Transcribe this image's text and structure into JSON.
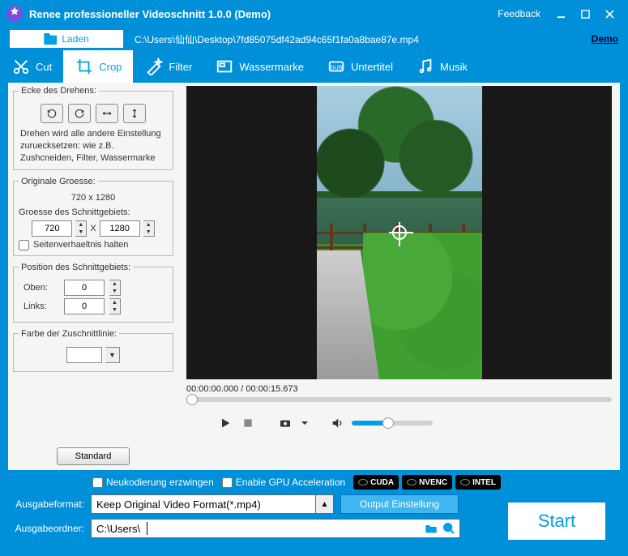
{
  "titlebar": {
    "title": "Renee professioneller Videoschnitt 1.0.0 (Demo)",
    "feedback": "Feedback"
  },
  "row1": {
    "load": "Laden",
    "filepath": "C:\\Users\\仙仙\\Desktop\\7fd85075df42ad94c65f1fa0a8bae87e.mp4",
    "demo": "Demo"
  },
  "tabs": {
    "cut": "Cut",
    "crop": "Crop",
    "filter": "Filter",
    "watermark": "Wassermarke",
    "subtitle": "Untertitel",
    "music": "Musik"
  },
  "panel": {
    "rotate": {
      "legend": "Ecke des Drehens:",
      "hint": "Drehen wird alle andere Einstellung zuruecksetzen: wie z.B. Zushcneiden, Filter, Wassermarke"
    },
    "origsize": {
      "legend": "Originale Groesse:",
      "value": "720 x 1280",
      "cropsize_label": "Groesse des Schnittgebiets:",
      "w": "720",
      "x": "X",
      "h": "1280",
      "keep_ratio": "Seitenverhaeltnis halten"
    },
    "pos": {
      "legend": "Position des Schnittgebiets:",
      "top_label": "Oben:",
      "top_val": "0",
      "left_label": "Links:",
      "left_val": "0"
    },
    "color": {
      "legend": "Farbe der Zuschnittlinie:"
    },
    "standard": "Standard"
  },
  "preview": {
    "time": "00:00:00.000 / 00:00:15.673"
  },
  "bottom": {
    "force_reencode": "Neukodierung erzwingen",
    "gpu": "Enable GPU Acceleration",
    "cuda": "CUDA",
    "nvenc": "NVENC",
    "intel": "INTEL",
    "format_label": "Ausgabeformat:",
    "format_value": "Keep Original Video Format(*.mp4)",
    "settings": "Output Einstellung",
    "folder_label": "Ausgabeordner:",
    "folder_value": "C:\\Users\\",
    "start": "Start"
  }
}
